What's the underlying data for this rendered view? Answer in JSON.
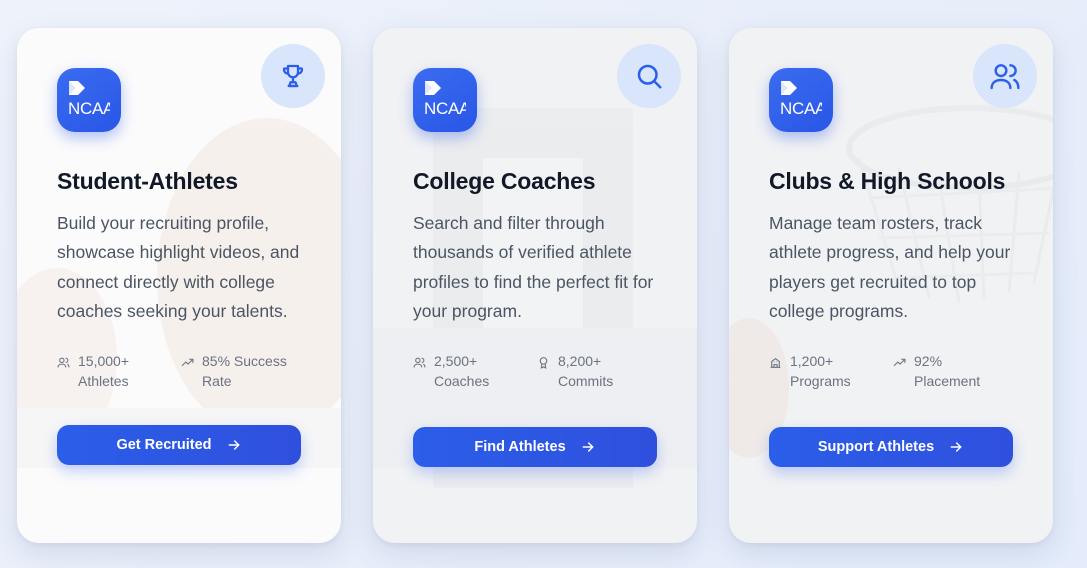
{
  "cards": [
    {
      "logo_text": "NCAA",
      "corner_icon": "trophy-icon",
      "title": "Student-Athletes",
      "description": "Build your recruiting profile, showcase highlight videos, and connect directly with college coaches seeking your talents.",
      "stats": [
        {
          "icon": "users-icon",
          "line1": "15,000+",
          "line2": "Athletes"
        },
        {
          "icon": "trending-up-icon",
          "line1": "85% Success",
          "line2": "Rate"
        }
      ],
      "cta_label": "Get Recruited"
    },
    {
      "logo_text": "NCAA",
      "corner_icon": "search-icon",
      "title": "College Coaches",
      "description": "Search and filter through thousands of verified athlete profiles to find the perfect fit for your program.",
      "stats": [
        {
          "icon": "users-icon",
          "line1": "2,500+",
          "line2": "Coaches"
        },
        {
          "icon": "award-icon",
          "line1": "8,200+",
          "line2": "Commits"
        }
      ],
      "cta_label": "Find Athletes"
    },
    {
      "logo_text": "NCAA",
      "corner_icon": "users-icon",
      "title": "Clubs & High Schools",
      "description": "Manage team rosters, track athlete progress, and help your players get recruited to top college programs.",
      "stats": [
        {
          "icon": "school-icon",
          "line1": "1,200+",
          "line2": "Programs"
        },
        {
          "icon": "trending-up-icon",
          "line1": "92%",
          "line2": "Placement"
        }
      ],
      "cta_label": "Support Athletes"
    }
  ],
  "colors": {
    "accent": "#2b5ee9",
    "badge_bg": "#d9e5fb",
    "title": "#111827",
    "body": "#4b5563",
    "muted": "#6b7280"
  }
}
